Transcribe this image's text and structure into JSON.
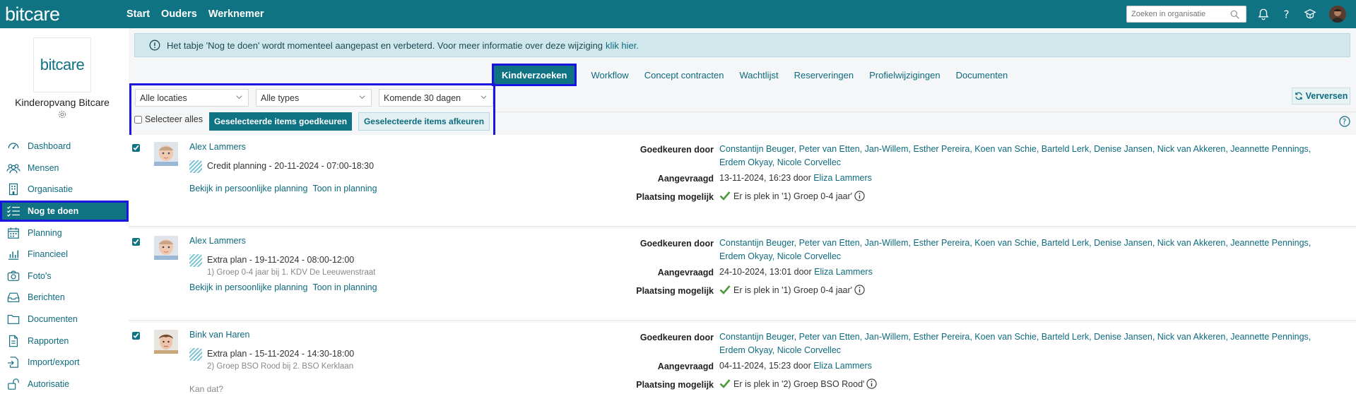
{
  "topbar": {
    "brand": "bitcare",
    "nav": [
      "Start",
      "Ouders",
      "Werknemer"
    ],
    "search_placeholder": "Zoeken in organisatie",
    "icons": [
      "search-icon",
      "bell-icon",
      "help-icon",
      "graduation-icon",
      "user-avatar"
    ]
  },
  "sidebar": {
    "logo_text": "bitcare",
    "org_name": "Kinderopvang Bitcare",
    "items": [
      {
        "label": "Dashboard",
        "icon": "dashboard-icon"
      },
      {
        "label": "Mensen",
        "icon": "people-icon"
      },
      {
        "label": "Organisatie",
        "icon": "building-icon"
      },
      {
        "label": "Nog te doen",
        "icon": "checklist-icon",
        "active": true
      },
      {
        "label": "Planning",
        "icon": "calendar-icon"
      },
      {
        "label": "Financieel",
        "icon": "chart-icon"
      },
      {
        "label": "Foto's",
        "icon": "camera-icon"
      },
      {
        "label": "Berichten",
        "icon": "inbox-icon"
      },
      {
        "label": "Documenten",
        "icon": "folder-icon"
      },
      {
        "label": "Rapporten",
        "icon": "report-icon"
      },
      {
        "label": "Import/export",
        "icon": "import-icon"
      },
      {
        "label": "Autorisatie",
        "icon": "lock-icon"
      }
    ]
  },
  "notice": {
    "text": "Het tabje 'Nog te doen' wordt momenteel aangepast en verbeterd. Voor meer informatie over deze wijziging",
    "link": "klik hier."
  },
  "tabs": [
    "Kindverzoeken",
    "Workflow",
    "Concept contracten",
    "Wachtlijst",
    "Reserveringen",
    "Profielwijzigingen",
    "Documenten"
  ],
  "filters": {
    "location": "Alle locaties",
    "type": "Alle types",
    "period": "Komende 30 dagen",
    "select_all": "Selecteer alles",
    "approve_button": "Geselecteerde items goedkeuren",
    "reject_button": "Geselecteerde items afkeuren",
    "refresh_button": "Verversen"
  },
  "labels": {
    "approvers": "Goedkeuren door",
    "requested": "Aangevraagd",
    "placement": "Plaatsing mogelijk",
    "view_personal": "Bekijk in persoonlijke planning",
    "show_planning": "Toon in planning"
  },
  "requests": [
    {
      "name": "Alex Lammers",
      "plan": "Credit planning - 20-11-2024 - 07:00-18:30",
      "sub": "",
      "note": "",
      "approvers_line1": "Constantijn Beuger, Peter van Etten, Jan-Willem, Esther Pereira, Koen van Schie, Barteld Lerk, Denise Jansen, Nick van Akkeren, Jeannette Pennings,",
      "approvers_line2": "Erdem Okyay, Nicole Corvellec",
      "requested_date": "13-11-2024, 16:23 door",
      "requested_by": "Eliza Lammers",
      "placement": "Er is plek in '1) Groep 0-4 jaar'"
    },
    {
      "name": "Alex Lammers",
      "plan": "Extra plan - 19-11-2024 - 08:00-12:00",
      "sub": "1) Groep 0-4 jaar bij 1. KDV De Leeuwenstraat",
      "note": "",
      "approvers_line1": "Constantijn Beuger, Peter van Etten, Jan-Willem, Esther Pereira, Koen van Schie, Barteld Lerk, Denise Jansen, Nick van Akkeren, Jeannette Pennings,",
      "approvers_line2": "Erdem Okyay, Nicole Corvellec",
      "requested_date": "24-10-2024, 13:01 door",
      "requested_by": "Eliza Lammers",
      "placement": "Er is plek in '1) Groep 0-4 jaar'"
    },
    {
      "name": "Bink van Haren",
      "plan": "Extra plan - 15-11-2024 - 14:30-18:00",
      "sub": "2) Groep BSO Rood bij 2. BSO Kerklaan",
      "note": "Kan dat?",
      "approvers_line1": "Constantijn Beuger, Peter van Etten, Jan-Willem, Esther Pereira, Koen van Schie, Barteld Lerk, Denise Jansen, Nick van Akkeren, Jeannette Pennings,",
      "approvers_line2": "Erdem Okyay, Nicole Corvellec",
      "requested_date": "04-11-2024, 15:23 door",
      "requested_by": "Eliza Lammers",
      "placement": "Er is plek in '2) Groep BSO Rood'"
    }
  ]
}
